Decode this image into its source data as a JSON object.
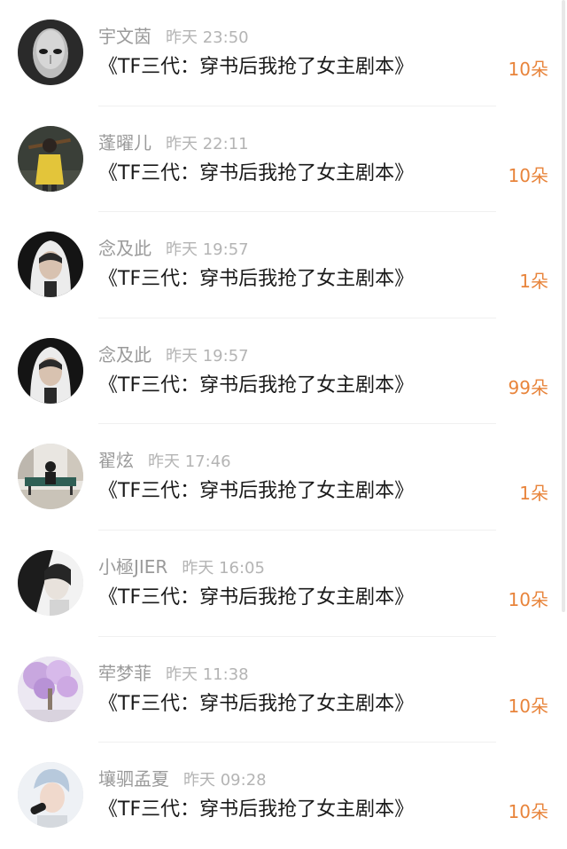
{
  "comments": [
    {
      "name": "宇文茵",
      "time": "昨天 23:50",
      "text": "《TF三代：穿书后我抢了女主剧本》",
      "gift": "10朵",
      "avatar_icon": "mask-face-avatar"
    },
    {
      "name": "蓬曜儿",
      "time": "昨天 22:11",
      "text": "《TF三代：穿书后我抢了女主剧本》",
      "gift": "10朵",
      "avatar_icon": "yellow-raincoat-character-avatar"
    },
    {
      "name": "念及此",
      "time": "昨天 19:57",
      "text": "《TF三代：穿书后我抢了女主剧本》",
      "gift": "1朵",
      "avatar_icon": "hooded-person-avatar"
    },
    {
      "name": "念及此",
      "time": "昨天 19:57",
      "text": "《TF三代：穿书后我抢了女主剧本》",
      "gift": "99朵",
      "avatar_icon": "hooded-person-avatar"
    },
    {
      "name": "翟炫",
      "time": "昨天 17:46",
      "text": "《TF三代：穿书后我抢了女主剧本》",
      "gift": "1朵",
      "avatar_icon": "bench-person-avatar"
    },
    {
      "name": "小極JIER",
      "time": "昨天 16:05",
      "text": "《TF三代：穿书后我抢了女主剧本》",
      "gift": "10朵",
      "avatar_icon": "bw-portrait-avatar"
    },
    {
      "name": "荦梦菲",
      "time": "昨天 11:38",
      "text": "《TF三代：穿书后我抢了女主剧本》",
      "gift": "10朵",
      "avatar_icon": "blossom-tree-avatar"
    },
    {
      "name": "壤驷孟夏",
      "time": "昨天 09:28",
      "text": "《TF三代：穿书后我抢了女主剧本》",
      "gift": "10朵",
      "avatar_icon": "singer-microphone-avatar"
    }
  ],
  "colors": {
    "gift": "#e8843b",
    "name": "#9a9a9a",
    "time": "#b4b4b4",
    "title": "#1a1a1a",
    "divider": "#f0f0f0"
  }
}
